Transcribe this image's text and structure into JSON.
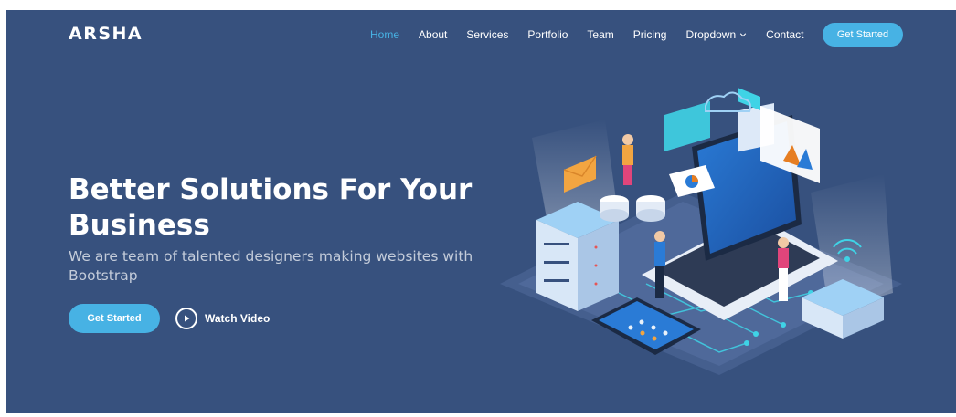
{
  "brand": {
    "logo": "ARSHA"
  },
  "nav": {
    "items": [
      {
        "label": "Home",
        "active": true
      },
      {
        "label": "About"
      },
      {
        "label": "Services"
      },
      {
        "label": "Portfolio"
      },
      {
        "label": "Team"
      },
      {
        "label": "Pricing"
      },
      {
        "label": "Dropdown"
      },
      {
        "label": "Contact"
      }
    ],
    "cta_label": "Get Started"
  },
  "hero": {
    "title": "Better Solutions For Your Business",
    "subtitle": "We are team of talented designers making websites with Bootstrap",
    "cta_label": "Get Started",
    "video_label": "Watch Video"
  },
  "icons": {
    "dropdown": "chevron-down-icon",
    "video": "play-icon"
  },
  "colors": {
    "background": "#37517e",
    "accent": "#47b2e4",
    "text": "#ffffff",
    "subtitle": "#c4ccda"
  }
}
